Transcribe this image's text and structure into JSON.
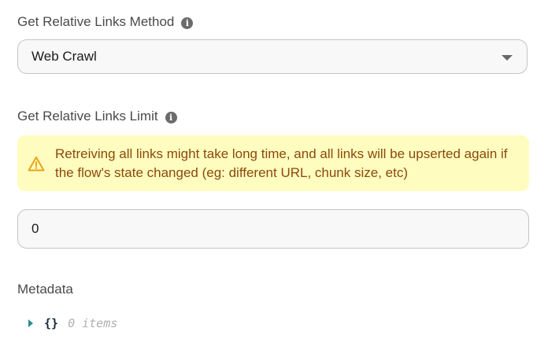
{
  "method_field": {
    "label": "Get Relative Links Method",
    "value": "Web Crawl"
  },
  "limit_field": {
    "label": "Get Relative Links Limit",
    "warning": "Retreiving all links might take long time, and all links will be upserted again if the flow's state changed (eg: different URL, chunk size, etc)",
    "value": "0"
  },
  "metadata_field": {
    "label": "Metadata",
    "braces": "{}",
    "count": "0 items"
  },
  "colors": {
    "warning_bg": "#fffcbf",
    "warning_text": "#8a4a0b",
    "warning_icon": "#e8a317",
    "expander": "#2e8b8b"
  },
  "icons": {
    "info": "info-icon",
    "dropdown": "chevron-down-icon",
    "warning": "warning-triangle-icon",
    "expand": "caret-right-icon"
  }
}
